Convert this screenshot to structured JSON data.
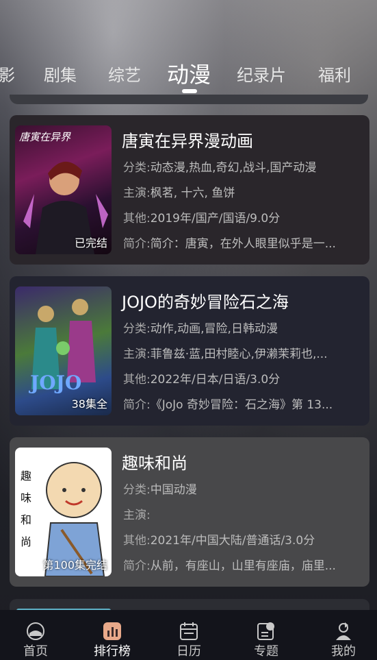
{
  "top_tabs": [
    {
      "label": "影"
    },
    {
      "label": "剧集"
    },
    {
      "label": "综艺"
    },
    {
      "label": "动漫",
      "active": true
    },
    {
      "label": "纪录片"
    },
    {
      "label": "福利"
    }
  ],
  "cards": [
    {
      "title": "唐寅在异界漫动画",
      "category_key": "分类:",
      "category": "动态漫,热血,奇幻,战斗,国产动漫",
      "cast_key": "主演:",
      "cast": "枫茗, 十六, 鱼饼",
      "other_key": "其他:",
      "other": "2019年/国产/国语/9.0分",
      "intro_key": "简介:",
      "intro": "简介：唐寅，在外人眼里似乎是一...",
      "badge": "已完结",
      "poster_text": "唐寅在异界"
    },
    {
      "title": "JOJO的奇妙冒险石之海",
      "category_key": "分类:",
      "category": "动作,动画,冒险,日韩动漫",
      "cast_key": "主演:",
      "cast": "菲鲁兹·蓝,田村睦心,伊濑茉莉也,...",
      "other_key": "其他:",
      "other": "2022年/日本/日语/3.0分",
      "intro_key": "简介:",
      "intro": "《JoJo 奇妙冒险：石之海》第 13...",
      "badge": "38集全",
      "poster_text": "JOJO"
    },
    {
      "title": "趣味和尚",
      "category_key": "分类:",
      "category": "中国动漫",
      "cast_key": "主演:",
      "cast": "",
      "other_key": "其他:",
      "other": "2021年/中国大陆/普通话/3.0分",
      "intro_key": "简介:",
      "intro": "从前，有座山，山里有座庙，庙里...",
      "badge": "第100集完结",
      "poster_text": "趣味和尚"
    }
  ],
  "bottom_nav": [
    {
      "label": "首页",
      "icon": "home-icon"
    },
    {
      "label": "排行榜",
      "icon": "ranking-icon",
      "active": true
    },
    {
      "label": "日历",
      "icon": "calendar-icon"
    },
    {
      "label": "专题",
      "icon": "topic-icon"
    },
    {
      "label": "我的",
      "icon": "profile-icon"
    }
  ]
}
